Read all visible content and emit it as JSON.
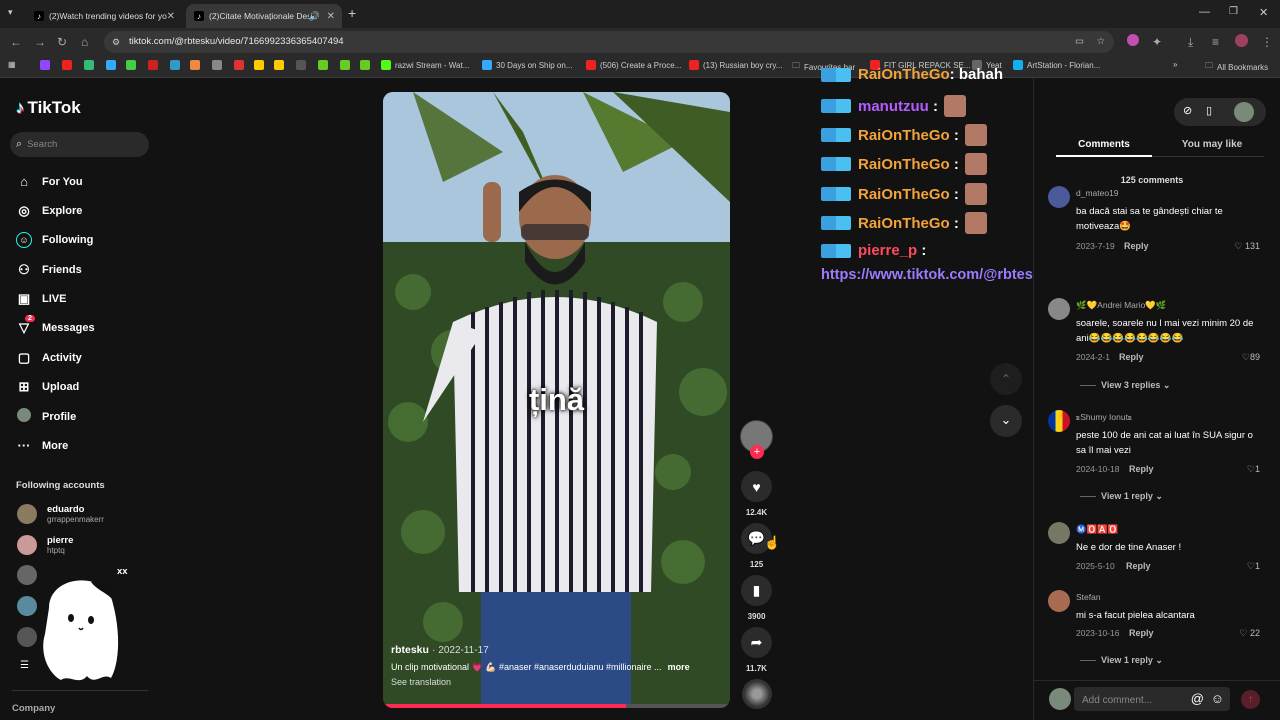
{
  "browser": {
    "tabs": [
      {
        "label": "(2)Watch trending videos for yo",
        "active": false
      },
      {
        "label": "(2)Citate Motivaționale Des",
        "active": true
      }
    ],
    "url": "tiktok.com/@rbtesku/video/7166992336365407494",
    "bookmarks": [
      "razwi Stream - Wat...",
      "30 Days on Ship on...",
      "(506) Create a Proce...",
      "(13) Russian boy cry...",
      "Favourites bar",
      "FIT GIRL REPACK SE...",
      "Yeat",
      "ArtStation - Florian...",
      "All Bookmarks"
    ]
  },
  "sidebar": {
    "logo": "TikTok",
    "search_placeholder": "Search",
    "nav": [
      {
        "label": "For You",
        "icon": "home-icon"
      },
      {
        "label": "Explore",
        "icon": "compass-icon"
      },
      {
        "label": "Following",
        "icon": "following-icon"
      },
      {
        "label": "Friends",
        "icon": "friends-icon"
      },
      {
        "label": "LIVE",
        "icon": "live-icon"
      },
      {
        "label": "Messages",
        "icon": "messages-icon",
        "badge": "2"
      },
      {
        "label": "Activity",
        "icon": "activity-icon"
      },
      {
        "label": "Upload",
        "icon": "upload-icon"
      },
      {
        "label": "Profile",
        "icon": "profile-icon"
      },
      {
        "label": "More",
        "icon": "more-icon"
      }
    ],
    "following_title": "Following accounts",
    "accounts": [
      {
        "name": "eduardo",
        "handle": "grrappenmakerr"
      },
      {
        "name": "pierre",
        "handle": "htptq"
      }
    ],
    "partial_account_text": "xx",
    "company": "Company"
  },
  "video": {
    "caption_overlay": "țină",
    "author": "rbtesku",
    "date": "2022-11-17",
    "description": "Un clip motivational 💗 💪🏻 #anaser #anaserduduianu  #millionaire  ...",
    "more": "more",
    "see_translation": "See translation"
  },
  "actions": {
    "likes": "12.4K",
    "comments": "125",
    "saves": "3900",
    "shares": "11.7K"
  },
  "chat": [
    {
      "user": "RaiOnTheGo",
      "color": "#f2a33a",
      "text": "bahah",
      "emote": false
    },
    {
      "user": "manutzuu",
      "color": "#b45cff",
      "text": "",
      "emote": true
    },
    {
      "user": "RaiOnTheGo",
      "color": "#f2a33a",
      "text": "",
      "emote": true
    },
    {
      "user": "RaiOnTheGo",
      "color": "#f2a33a",
      "text": "",
      "emote": true
    },
    {
      "user": "RaiOnTheGo",
      "color": "#f2a33a",
      "text": "",
      "emote": true
    },
    {
      "user": "RaiOnTheGo",
      "color": "#f2a33a",
      "text": "",
      "emote": true
    },
    {
      "user": "pierre_p",
      "color": "#ff4a5c",
      "text": "",
      "emote": false
    }
  ],
  "chat_link": "https://www.tiktok.com/@rbtesku/video/7166992336365407494",
  "comments_panel": {
    "tab_comments": "Comments",
    "tab_you_may_like": "You may like",
    "count_label": "125 comments",
    "comments": [
      {
        "user": "d_mateo19",
        "text": "ba dacă stai sa te gândești chiar te motiveaza🤩",
        "date": "2023-7-19",
        "reply": "Reply",
        "likes": "131",
        "view_replies": ""
      },
      {
        "user": "🌿💛Andrei Mario💛🌿",
        "text": "soarele, soarele nu l mai vezi minim 20 de ani😂😂😂😂😂😂😂😂",
        "date": "2024-2-1",
        "reply": "Reply",
        "likes": "89",
        "view_replies": "View 3 replies"
      },
      {
        "user": "ꭱShumy Ionutꭱ",
        "text": "peste 100 de ani cat ai luat în SUA sigur o sa îl mai vezi",
        "date": "2024-10-18",
        "reply": "Reply",
        "likes": "1",
        "view_replies": "View 1 reply"
      },
      {
        "user": "Ⓜ️🅾️🅰️🅾️",
        "text": "Ne e dor de tine Anaser !",
        "date": "2025-5-10",
        "reply": "Reply",
        "likes": "1",
        "view_replies": ""
      },
      {
        "user": "Stefan",
        "text": "mi s-a facut pielea alcantara",
        "date": "2023-10-16",
        "reply": "Reply",
        "likes": "22",
        "view_replies": "View 1 reply"
      }
    ],
    "add_comment_placeholder": "Add comment..."
  },
  "colors": {
    "tiktok_red": "#fe2c55",
    "accent_chat_link": "#9b7bff"
  }
}
